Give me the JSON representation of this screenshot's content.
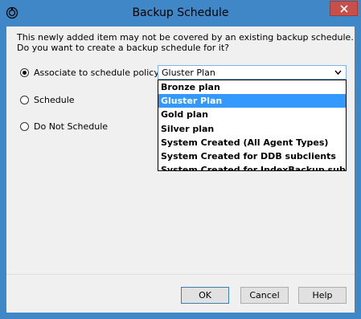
{
  "window": {
    "title": "Backup Schedule",
    "icon": "app-icon"
  },
  "message": {
    "line1": "This newly added item may not be covered by an existing backup schedule.",
    "line2": "Do you want to create a backup schedule for it?"
  },
  "options": {
    "associate": "Associate to schedule policy",
    "schedule": "Schedule",
    "do_not": "Do Not Schedule",
    "selected": "associate"
  },
  "combo": {
    "value": "Gluster Plan",
    "items": [
      "Bronze plan",
      "Gluster Plan",
      "Gold plan",
      "Silver plan",
      "System Created (All  Agent Types)",
      "System Created for DDB subclients",
      "System Created for IndexBackup subclients"
    ],
    "highlighted_index": 1
  },
  "buttons": {
    "ok": "OK",
    "cancel": "Cancel",
    "help": "Help"
  }
}
